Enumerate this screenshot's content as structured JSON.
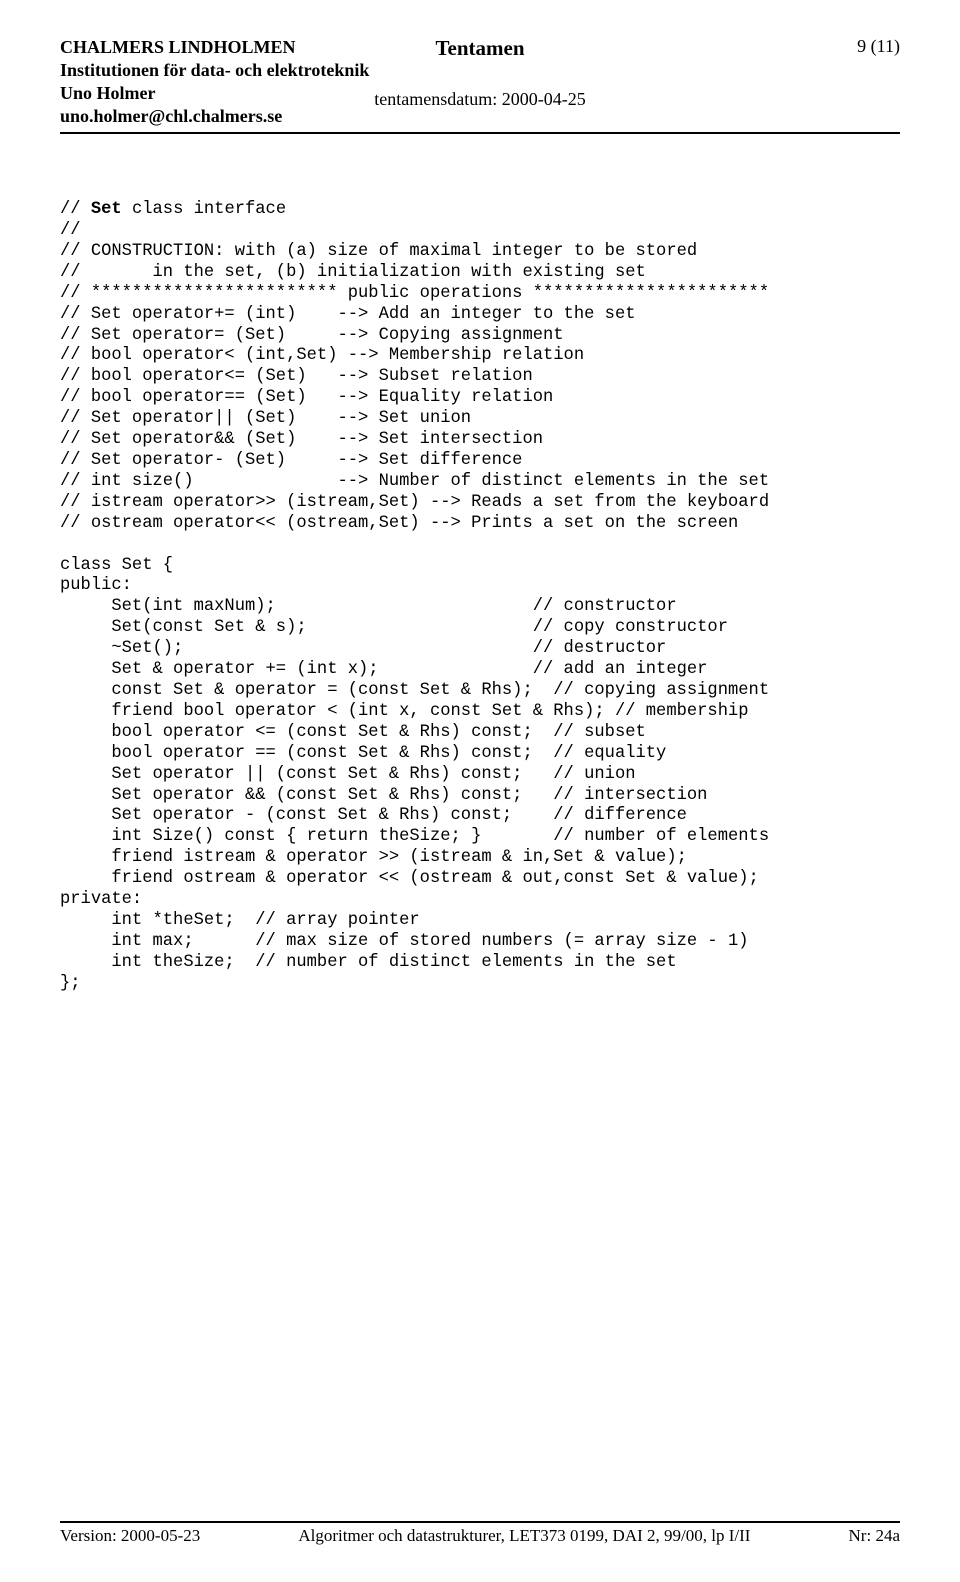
{
  "header": {
    "left": {
      "line1": "CHALMERS LINDHOLMEN",
      "line2": "Institutionen för data- och elektroteknik",
      "line3": "Uno Holmer",
      "line4": "uno.holmer@chl.chalmers.se"
    },
    "center": {
      "title": "Tentamen",
      "date": "tentamensdatum: 2000-04-25"
    },
    "right": "9 (11)"
  },
  "code": {
    "comments": [
      "// Set class interface",
      "//",
      "// CONSTRUCTION: with (a) size of maximal integer to be stored",
      "//       in the set, (b) initialization with existing set",
      "// ************************ public operations ***********************",
      "// Set operator+= (int)    --> Add an integer to the set",
      "// Set operator= (Set)     --> Copying assignment",
      "// bool operator< (int,Set) --> Membership relation",
      "// bool operator<= (Set)   --> Subset relation",
      "// bool operator== (Set)   --> Equality relation",
      "// Set operator|| (Set)    --> Set union",
      "// Set operator&& (Set)    --> Set intersection",
      "// Set operator- (Set)     --> Set difference",
      "// int size()              --> Number of distinct elements in the set",
      "// istream operator>> (istream,Set) --> Reads a set from the keyboard",
      "// ostream operator<< (ostream,Set) --> Prints a set on the screen"
    ],
    "body": [
      "",
      "class Set {",
      "public:",
      "     Set(int maxNum);                         // constructor",
      "     Set(const Set & s);                      // copy constructor",
      "     ~Set();                                  // destructor",
      "     Set & operator += (int x);               // add an integer",
      "     const Set & operator = (const Set & Rhs);  // copying assignment",
      "     friend bool operator < (int x, const Set & Rhs); // membership",
      "     bool operator <= (const Set & Rhs) const;  // subset",
      "     bool operator == (const Set & Rhs) const;  // equality",
      "     Set operator || (const Set & Rhs) const;   // union",
      "     Set operator && (const Set & Rhs) const;   // intersection",
      "     Set operator - (const Set & Rhs) const;    // difference",
      "     int Size() const { return theSize; }       // number of elements",
      "     friend istream & operator >> (istream & in,Set & value);",
      "     friend ostream & operator << (ostream & out,const Set & value);",
      "private:",
      "     int *theSet;  // array pointer",
      "     int max;      // max size of stored numbers (= array size - 1)",
      "     int theSize;  // number of distinct elements in the set",
      "};"
    ],
    "set_word": "Set"
  },
  "footer": {
    "left": "Version: 2000-05-23",
    "center": "Algoritmer och datastrukturer, LET373 0199, DAI 2, 99/00, lp I/II",
    "right": "Nr: 24a"
  }
}
